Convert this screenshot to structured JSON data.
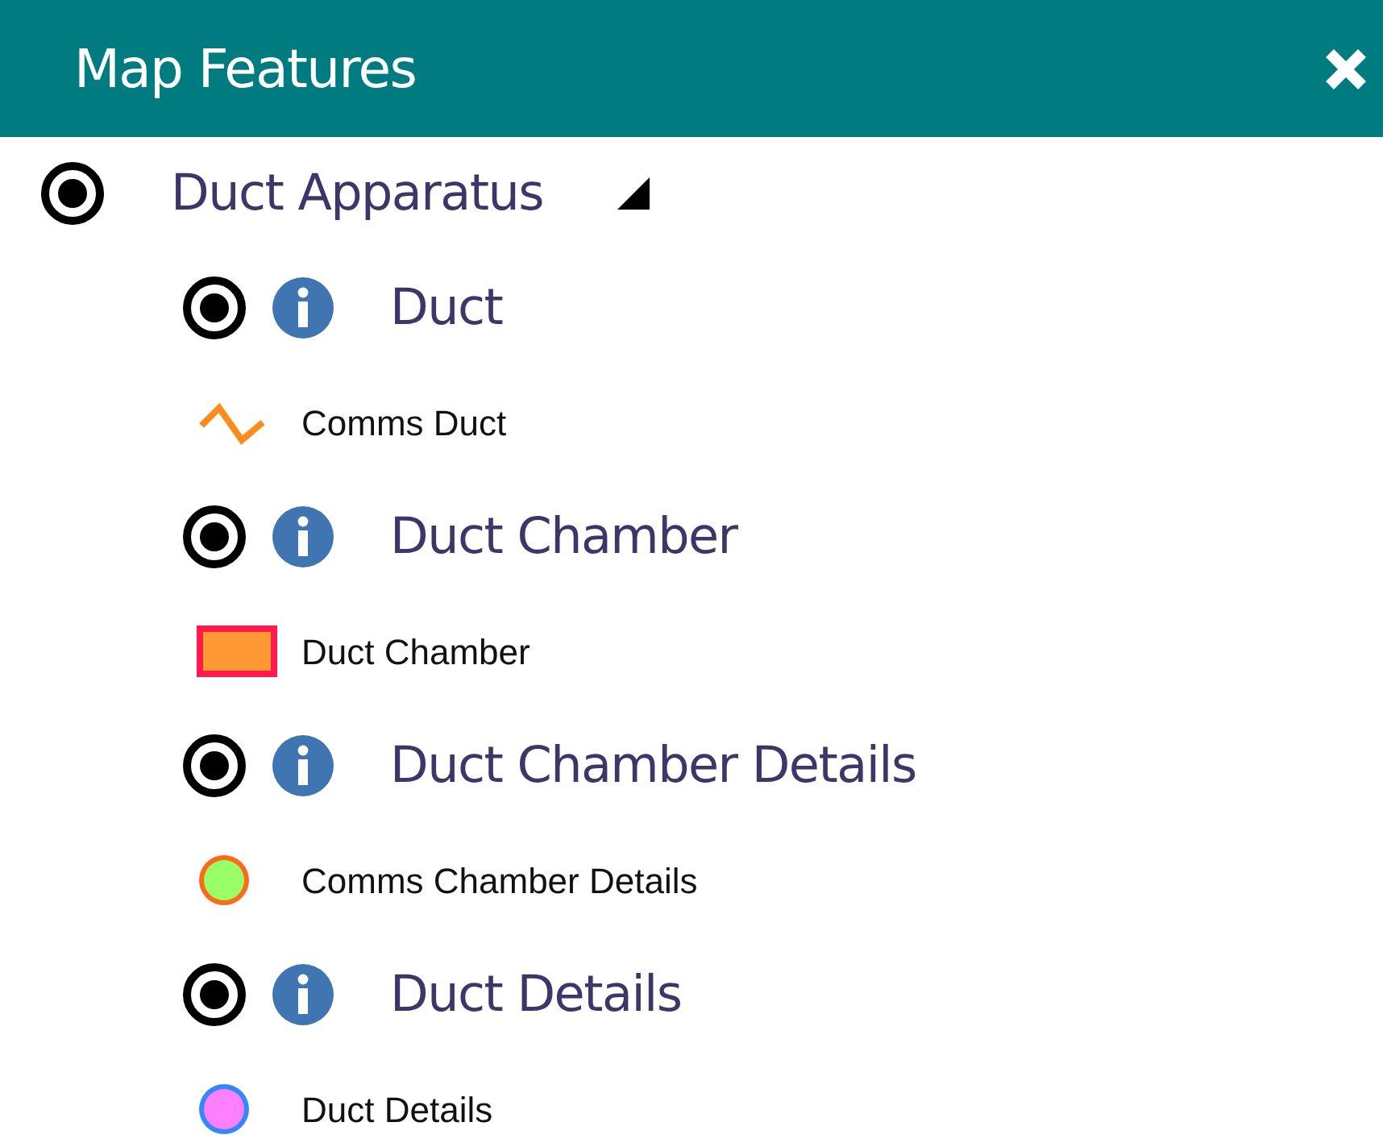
{
  "panel": {
    "title": "Map Features"
  },
  "group": {
    "name": "Duct Apparatus",
    "selected": true,
    "expanded": true,
    "layers": [
      {
        "name": "Duct",
        "selected": true,
        "legend": {
          "kind": "line",
          "label": "Comms Duct",
          "color": "#ff8c1a"
        }
      },
      {
        "name": "Duct Chamber",
        "selected": true,
        "legend": {
          "kind": "rect",
          "label": "Duct Chamber",
          "color": "#ff9933",
          "outline": {
            "color": "#ff1a4d"
          }
        }
      },
      {
        "name": "Duct Chamber Details",
        "selected": true,
        "legend": {
          "kind": "circle",
          "label": "Comms Chamber Details",
          "color": "#99ff66",
          "outline": {
            "color": "#ff6a1a"
          }
        }
      },
      {
        "name": "Duct Details",
        "selected": true,
        "legend": {
          "kind": "circle",
          "label": "Duct Details",
          "color": "#ff80ff",
          "outline": {
            "color": "#3388ff"
          }
        }
      }
    ]
  }
}
